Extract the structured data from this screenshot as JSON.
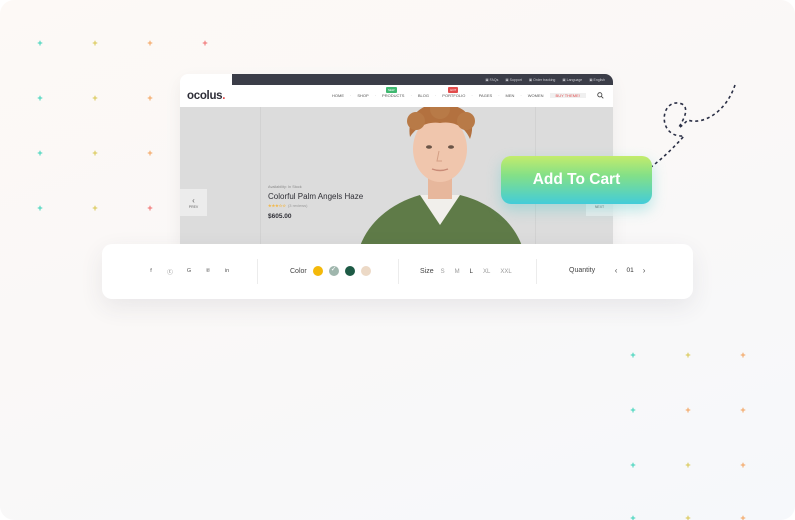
{
  "browser": {
    "topbar_links": [
      "▣ FAQs",
      "▣ Support",
      "▣ Order tracking",
      "▣ Language",
      "▣ English"
    ],
    "logo": "ocolus",
    "logo_dot": ".",
    "nav": [
      {
        "label": "HOME"
      },
      {
        "label": "SHOP"
      },
      {
        "label": "PRODUCTS",
        "badge": "NEW"
      },
      {
        "label": "BLOG"
      },
      {
        "label": "PORTFOLIO",
        "badge": "HOT"
      },
      {
        "label": "PAGES"
      },
      {
        "label": "MEN"
      },
      {
        "label": "WOMEN"
      },
      {
        "label": "BUY THEME!"
      }
    ]
  },
  "hero": {
    "availability": "Availability: In Stock",
    "product_name": "Colorful Palm Angels Haze",
    "stars": "★★★☆☆",
    "reviews": "(3 reviews)",
    "price": "$605.00",
    "prev_label": "PREV",
    "next_label": "NEXT",
    "prev_arrow": "‹",
    "next_arrow": "›"
  },
  "cta": {
    "add_to_cart": "Add To Cart"
  },
  "options": {
    "social": [
      "f",
      "ⓣ",
      "G",
      "℗",
      "in"
    ],
    "color_label": "Color",
    "colors": [
      "#f4b90a",
      "#9fb6ad",
      "#1d5a45",
      "#ecd9c6"
    ],
    "color_check": "✓",
    "size_label": "Size",
    "sizes": [
      "S",
      "M",
      "L",
      "XL",
      "XXL"
    ],
    "quantity_label": "Quantity",
    "qty_minus": "‹",
    "qty_plus": "›",
    "quantity": "01"
  }
}
